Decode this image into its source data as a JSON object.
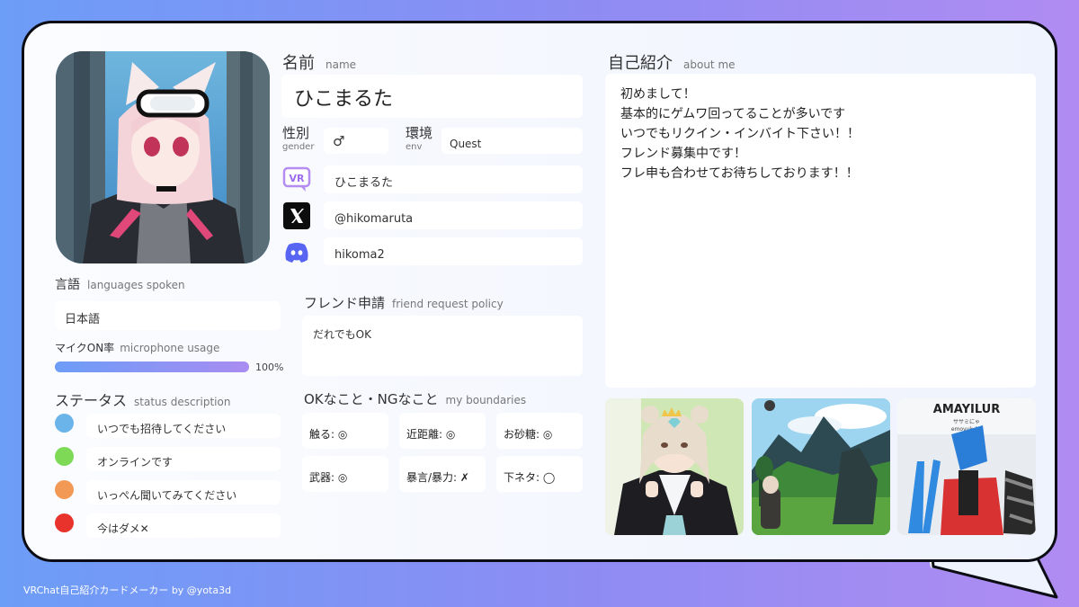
{
  "name": {
    "label_jp": "名前",
    "label_en": "name",
    "value": "ひこまるた"
  },
  "gender": {
    "label_jp": "性別",
    "label_en": "gender",
    "value": "♂"
  },
  "env": {
    "label_jp": "環境",
    "label_en": "env",
    "value": "Quest"
  },
  "accounts": {
    "vrchat": {
      "icon": "vrchat-logo-icon",
      "value": "ひこまるた"
    },
    "x": {
      "icon": "x-logo-icon",
      "value": "@hikomaruta"
    },
    "discord": {
      "icon": "discord-logo-icon",
      "value": "hikoma2"
    }
  },
  "languages": {
    "label_jp": "言語",
    "label_en": "languages spoken",
    "value": "日本語"
  },
  "mic": {
    "label_jp": "マイクON率",
    "label_en": "microphone usage",
    "percent_label": "100%",
    "fraction": 1.0
  },
  "status": {
    "label_jp": "ステータス",
    "label_en": "status description",
    "items": [
      {
        "color": "#6ab4ea",
        "text": "いつでも招待してください"
      },
      {
        "color": "#7ed957",
        "text": "オンラインです"
      },
      {
        "color": "#f29a55",
        "text": "いっぺん聞いてみてください"
      },
      {
        "color": "#e8332c",
        "text": "今はダメ✕"
      }
    ]
  },
  "friend": {
    "label_jp": "フレンド申請",
    "label_en": "friend request policy",
    "value": "だれでもOK"
  },
  "boundaries": {
    "label_jp": "OKなこと・NGなこと",
    "label_en": "my boundaries",
    "items": [
      "触る: ◎",
      "近距離: ◎",
      "お砂糖: ◎",
      "武器: ◎",
      "暴言/暴力: ✗",
      "下ネタ: ◯"
    ]
  },
  "about": {
    "label_jp": "自己紹介",
    "label_en": "about me",
    "lines": [
      "初めまして！",
      "基本的にゲムワ回ってることが多いです",
      "いつでもリクイン・インバイト下さい！！",
      "フレンド募集中です！",
      "フレ申も合わせてお待ちしております！！"
    ]
  },
  "photo_sign": {
    "title": "AMAYILUR",
    "sub": "ササミにゃ",
    "sub2": "emoyuk_kd"
  },
  "footer": "VRChat自己紹介カードメーカー by @yota3d"
}
